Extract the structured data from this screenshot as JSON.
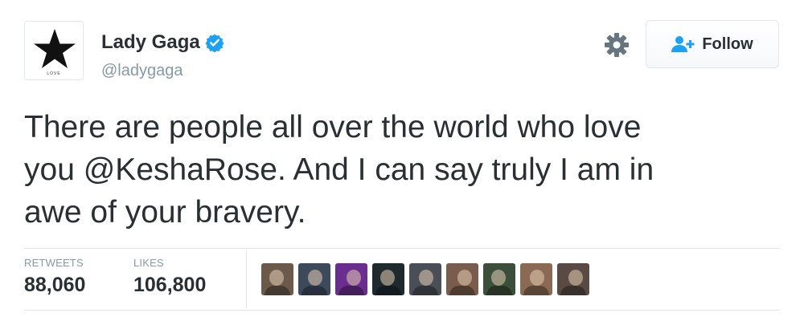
{
  "user": {
    "display_name": "Lady Gaga",
    "handle": "@ladygaga",
    "verified": true,
    "avatar_icon": "black-star-icon",
    "avatar_caption": "LOVE"
  },
  "actions": {
    "settings_icon": "gear-icon",
    "follow_label": "Follow",
    "follow_icon": "add-user-icon"
  },
  "tweet": {
    "text_line1": "There are people all over the world who love",
    "text_prefix": "you ",
    "mention": "@KeshaRose",
    "text_suffix": ". And I can say truly I am in",
    "text_line3": "awe of your bravery."
  },
  "stats": {
    "retweets_label": "RETWEETS",
    "retweets_value": "88,060",
    "likes_label": "LIKES",
    "likes_value": "106,800"
  },
  "likers": [
    {
      "name": "liker-avatar-1",
      "bg": "#6b5a4a"
    },
    {
      "name": "liker-avatar-2",
      "bg": "#3d4a5c"
    },
    {
      "name": "liker-avatar-3",
      "bg": "#6a2f8e"
    },
    {
      "name": "liker-avatar-4",
      "bg": "#1e2a2e"
    },
    {
      "name": "liker-avatar-5",
      "bg": "#4a4f57"
    },
    {
      "name": "liker-avatar-6",
      "bg": "#7a5c4c"
    },
    {
      "name": "liker-avatar-7",
      "bg": "#3b4f3a"
    },
    {
      "name": "liker-avatar-8",
      "bg": "#8a6a55"
    },
    {
      "name": "liker-avatar-9",
      "bg": "#5a4a44"
    }
  ],
  "colors": {
    "verified_blue": "#1da1f2",
    "follow_icon_blue": "#1da1f2",
    "muted_gray": "#8899a6",
    "text": "#292f33"
  }
}
